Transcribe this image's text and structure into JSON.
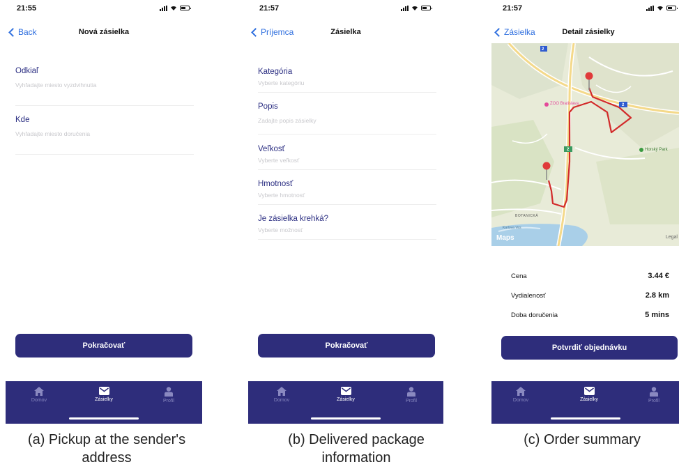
{
  "screens": [
    {
      "time": "21:55",
      "nav": {
        "back": "Back",
        "title": "Nová zásielka"
      },
      "fields": [
        {
          "label": "Odkiaľ",
          "placeholder": "Vyhľadajte miesto vyzdvihnutia"
        },
        {
          "label": "Kde",
          "placeholder": "Vyhľadajte miesto doručenia"
        }
      ],
      "button": "Pokračovať",
      "tabs": [
        "Domov",
        "Zásielky",
        "Profil"
      ],
      "active_tab": 1,
      "caption": "(a) Pickup at the sender's address"
    },
    {
      "time": "21:57",
      "nav": {
        "back": "Príjemca",
        "title": "Zásielka"
      },
      "fields": [
        {
          "label": "Kategória",
          "placeholder": "Vyberte kategóriu"
        },
        {
          "label": "Popis",
          "placeholder": "Zadajte popis zásielky"
        },
        {
          "label": "Veľkosť",
          "placeholder": "Vyberte veľkosť"
        },
        {
          "label": "Hmotnosť",
          "placeholder": "Vyberte hmotnosť"
        },
        {
          "label": "Je zásielka krehká?",
          "placeholder": "Vyberte možnosť"
        }
      ],
      "button": "Pokračovať",
      "tabs": [
        "Domov",
        "Zásielky",
        "Profil"
      ],
      "active_tab": 1,
      "caption": "(b) Delivered package information"
    },
    {
      "time": "21:57",
      "nav": {
        "back": "Zásielka",
        "title": "Detail zásielky"
      },
      "map": {
        "labels": [
          "ZOO Bratislava",
          "Horský Park",
          "BOTANICKÁ",
          "Karlova Ves"
        ],
        "road_shields": [
          "2",
          "2",
          "2"
        ],
        "brand": "Maps",
        "legal": "Legal"
      },
      "summary": [
        {
          "key": "Cena",
          "value": "3.44 €"
        },
        {
          "key": "Vydialenosť",
          "value": "2.8 km"
        },
        {
          "key": "Doba doručenia",
          "value": "5 mins"
        }
      ],
      "button": "Potvrdiť objednávku",
      "tabs": [
        "Domov",
        "Zásielky",
        "Profil"
      ],
      "active_tab": 1,
      "caption": "(c) Order summary"
    }
  ],
  "colors": {
    "accent": "#2e2d7b",
    "link": "#2f6fdf",
    "label": "#2b2e82",
    "route": "#d22a2a",
    "tab_inactive": "#8a89c0"
  },
  "icons": [
    "back-chevron-icon",
    "home-icon",
    "mail-icon",
    "person-icon",
    "pin-icon"
  ]
}
